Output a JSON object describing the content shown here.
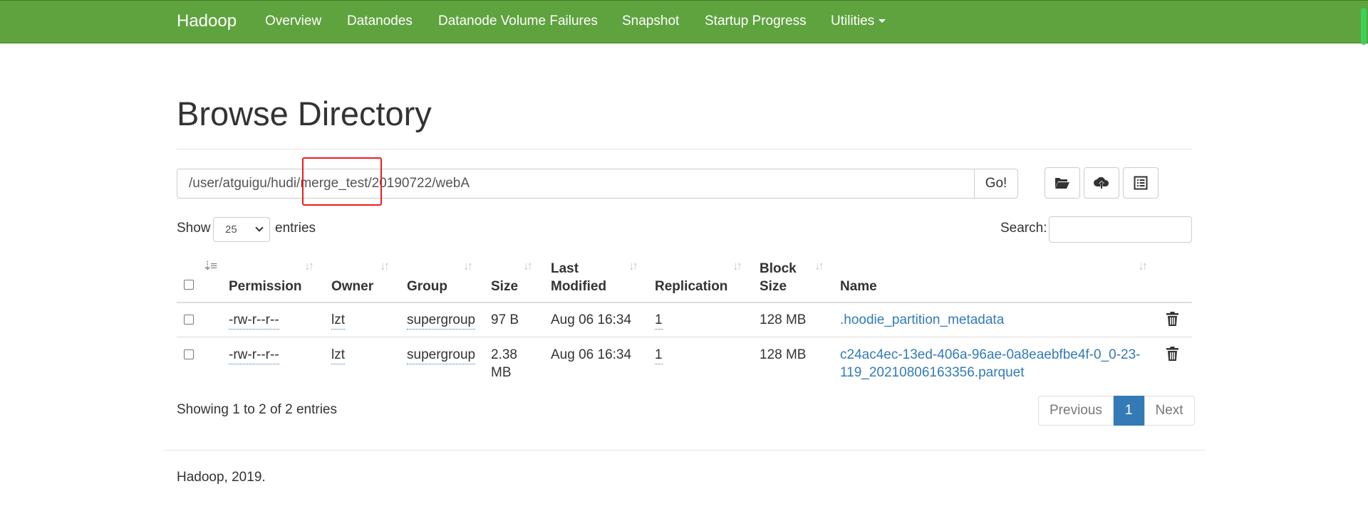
{
  "navbar": {
    "brand": "Hadoop",
    "items": [
      {
        "label": "Overview"
      },
      {
        "label": "Datanodes"
      },
      {
        "label": "Datanode Volume Failures"
      },
      {
        "label": "Snapshot"
      },
      {
        "label": "Startup Progress"
      },
      {
        "label": "Utilities"
      }
    ]
  },
  "page": {
    "title": "Browse Directory"
  },
  "path_bar": {
    "path_value": "/user/atguigu/hudi/merge_test/20190722/webA",
    "go_label": "Go!",
    "tools": [
      {
        "icon": "folder-open-icon"
      },
      {
        "icon": "cloud-upload-icon"
      },
      {
        "icon": "list-icon"
      }
    ]
  },
  "controls": {
    "show_label": "Show",
    "entries_value": "25",
    "entries_label": "entries",
    "search_label": "Search:",
    "search_value": ""
  },
  "table": {
    "columns": {
      "permission": "Permission",
      "owner": "Owner",
      "group": "Group",
      "size": "Size",
      "last_modified_1": "Last",
      "last_modified_2": "Modified",
      "replication": "Replication",
      "block_size_1": "Block",
      "block_size_2": "Size",
      "name": "Name"
    },
    "rows": [
      {
        "permission": "-rw-r--r--",
        "owner": "lzt",
        "group": "supergroup",
        "size": "97 B",
        "size_line2": "",
        "last_modified": "Aug 06 16:34",
        "replication": "1",
        "block_size": "128 MB",
        "name": ".hoodie_partition_metadata",
        "name_line2": ""
      },
      {
        "permission": "-rw-r--r--",
        "owner": "lzt",
        "group": "supergroup",
        "size": "2.38",
        "size_line2": "MB",
        "last_modified": "Aug 06 16:34",
        "replication": "1",
        "block_size": "128 MB",
        "name": "c24ac4ec-13ed-406a-96ae-0a8eaebfbe4f-0_0-23-",
        "name_line2": "119_20210806163356.parquet"
      }
    ]
  },
  "pagination": {
    "summary": "Showing 1 to 2 of 2 entries",
    "previous": "Previous",
    "current": "1",
    "next": "Next"
  },
  "footer": {
    "text": "Hadoop, 2019."
  },
  "colors": {
    "navbar_bg": "#5fa33e",
    "link": "#337ab7",
    "highlight": "#ee1c1c"
  }
}
